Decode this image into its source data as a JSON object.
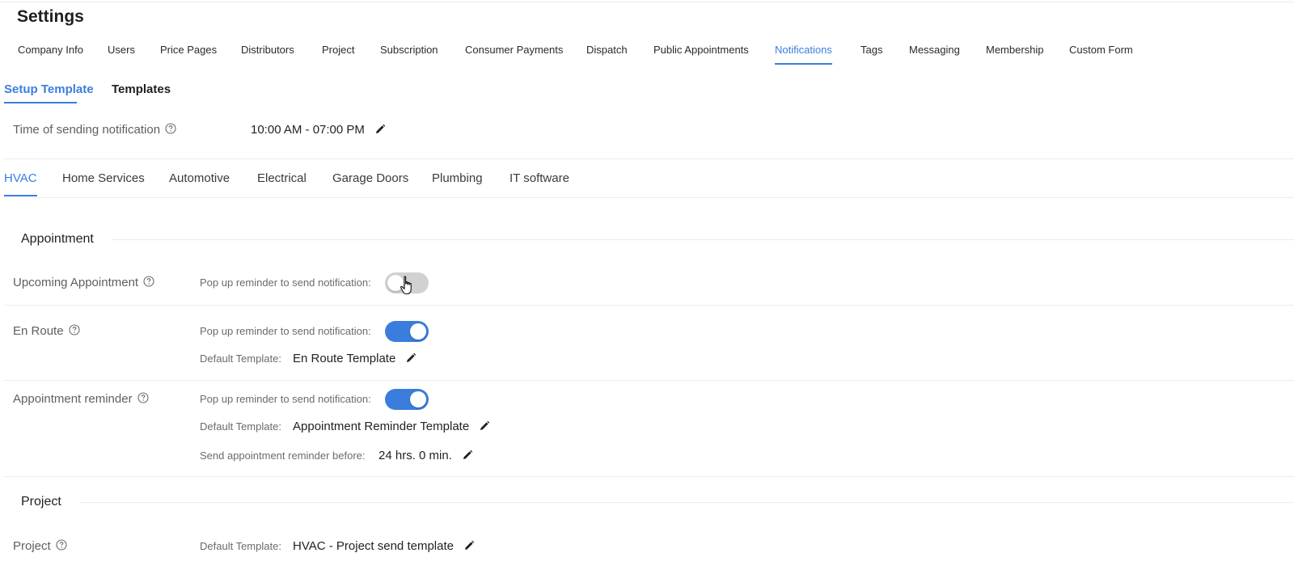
{
  "page": {
    "title": "Settings"
  },
  "main_tabs": [
    {
      "label": "Company Info"
    },
    {
      "label": "Users"
    },
    {
      "label": "Price Pages"
    },
    {
      "label": "Distributors"
    },
    {
      "label": "Project"
    },
    {
      "label": "Subscription"
    },
    {
      "label": "Consumer Payments"
    },
    {
      "label": "Dispatch"
    },
    {
      "label": "Public Appointments"
    },
    {
      "label": "Notifications",
      "active": true
    },
    {
      "label": "Tags"
    },
    {
      "label": "Messaging"
    },
    {
      "label": "Membership"
    },
    {
      "label": "Custom Form"
    }
  ],
  "sub_tabs": [
    {
      "label": "Setup Template",
      "active": true
    },
    {
      "label": "Templates"
    }
  ],
  "sending_time": {
    "label": "Time of sending notification",
    "value": "10:00 AM - 07:00 PM"
  },
  "industry_tabs": [
    {
      "label": "HVAC",
      "active": true
    },
    {
      "label": "Home Services"
    },
    {
      "label": "Automotive"
    },
    {
      "label": "Electrical"
    },
    {
      "label": "Garage Doors"
    },
    {
      "label": "Plumbing"
    },
    {
      "label": "IT software"
    }
  ],
  "appointment": {
    "title": "Appointment",
    "upcoming": {
      "label": "Upcoming Appointment",
      "popup_label": "Pop up reminder to send notification:",
      "toggle": "off"
    },
    "en_route": {
      "label": "En Route",
      "popup_label": "Pop up reminder to send notification:",
      "toggle": "on",
      "template_label": "Default Template:",
      "template_value": "En Route Template"
    },
    "reminder": {
      "label": "Appointment reminder",
      "popup_label": "Pop up reminder to send notification:",
      "toggle": "on",
      "template_label": "Default Template:",
      "template_value": "Appointment Reminder Template",
      "before_label": "Send appointment reminder before:",
      "before_value": "24 hrs. 0 min."
    }
  },
  "project": {
    "title": "Project",
    "row": {
      "label": "Project",
      "template_label": "Default Template:",
      "template_value": "HVAC - Project send template"
    }
  },
  "colors": {
    "accent": "#3b7ddd",
    "toggle_off": "#d1d1d1"
  },
  "icons": {
    "help": "question-circle-icon",
    "edit": "pencil-icon",
    "cursor": "hand-pointer-icon"
  }
}
